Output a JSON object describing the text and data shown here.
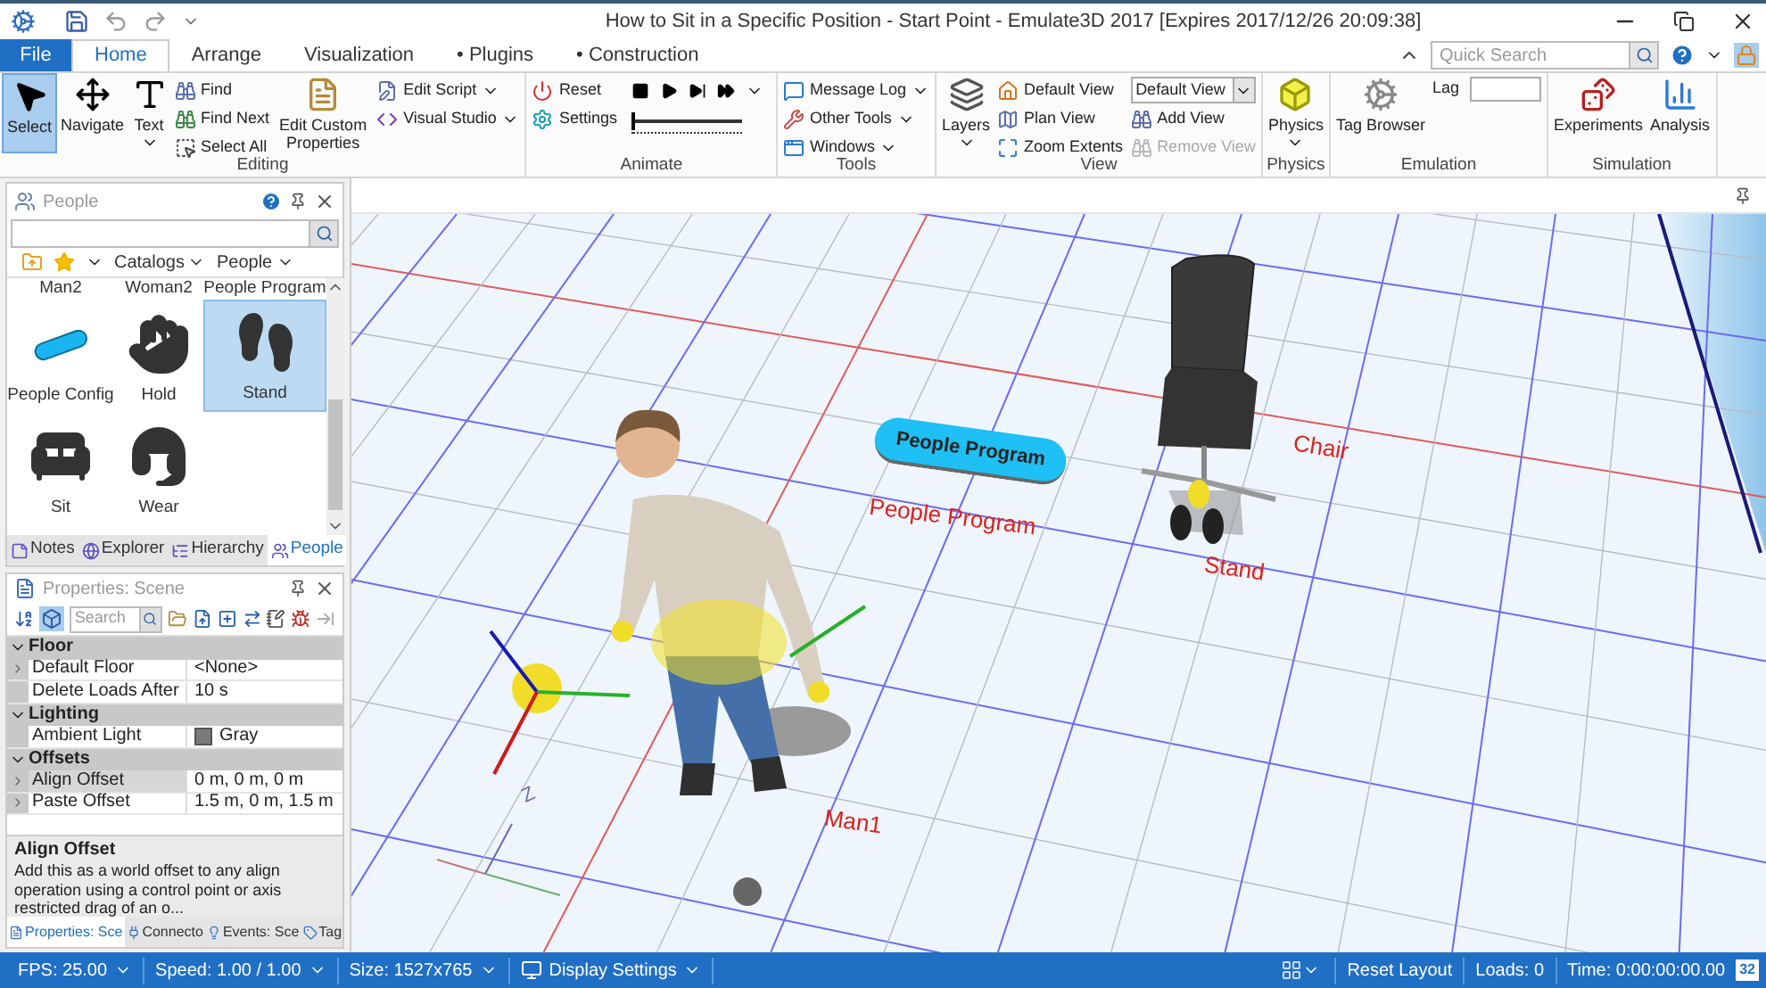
{
  "window": {
    "title": "How to Sit in a Specific Position - Start Point - Emulate3D 2017 [Expires 2017/12/26 20:09:38]"
  },
  "ribbon": {
    "tabs": [
      {
        "label": "File",
        "kind": "file",
        "selected": false
      },
      {
        "label": "Home",
        "kind": "tab",
        "selected": true
      },
      {
        "label": "Arrange",
        "kind": "tab",
        "selected": false
      },
      {
        "label": "Visualization",
        "kind": "tab",
        "selected": false
      },
      {
        "label": "• Plugins",
        "kind": "tab",
        "selected": false
      },
      {
        "label": "• Construction",
        "kind": "tab",
        "selected": false
      }
    ],
    "quick_search": {
      "placeholder": "Quick Search"
    },
    "groups": [
      {
        "label": "Editing",
        "items": [
          {
            "kind": "large",
            "label": "Select",
            "selected": true,
            "dropdown": false
          },
          {
            "kind": "large",
            "label": "Navigate",
            "selected": false,
            "dropdown": false
          },
          {
            "kind": "large",
            "label": "Text",
            "selected": false,
            "dropdown": true
          },
          {
            "kind": "stack",
            "items": [
              {
                "kind": "small",
                "label": "Find",
                "dropdown": false,
                "disabled": false
              },
              {
                "kind": "small",
                "label": "Find Next",
                "dropdown": false,
                "disabled": false
              },
              {
                "kind": "small",
                "label": "Select All",
                "dropdown": false,
                "disabled": false
              }
            ]
          },
          {
            "kind": "large",
            "label": "Edit Custom Properties",
            "selected": false,
            "dropdown": false
          },
          {
            "kind": "stack",
            "items": [
              {
                "kind": "small",
                "label": "Edit Script",
                "dropdown": true,
                "disabled": false
              },
              {
                "kind": "small",
                "label": "Visual Studio",
                "dropdown": true,
                "disabled": false
              }
            ]
          }
        ]
      },
      {
        "label": "Animate",
        "items": [
          {
            "kind": "stack",
            "items": [
              {
                "kind": "small",
                "label": "Reset",
                "dropdown": false,
                "disabled": false
              },
              {
                "kind": "small",
                "label": "Settings",
                "dropdown": false,
                "disabled": false
              }
            ]
          },
          {
            "kind": "stack",
            "items": [
              {
                "kind": "transport"
              },
              {
                "kind": "slider",
                "level": 0
              }
            ]
          }
        ]
      },
      {
        "label": "Tools",
        "items": [
          {
            "kind": "stack",
            "items": [
              {
                "kind": "small",
                "label": "Message Log",
                "dropdown": true,
                "disabled": false
              },
              {
                "kind": "small",
                "label": "Other Tools",
                "dropdown": true,
                "disabled": false
              },
              {
                "kind": "small",
                "label": "Windows",
                "dropdown": true,
                "disabled": false
              }
            ]
          }
        ]
      },
      {
        "label": "View",
        "items": [
          {
            "kind": "large",
            "label": "Layers",
            "selected": false,
            "dropdown": true
          },
          {
            "kind": "stack",
            "items": [
              {
                "kind": "small",
                "label": "Default View",
                "dropdown": false,
                "disabled": false
              },
              {
                "kind": "small",
                "label": "Plan View",
                "dropdown": false,
                "disabled": false
              },
              {
                "kind": "small",
                "label": "Zoom Extents",
                "dropdown": false,
                "disabled": false
              }
            ]
          },
          {
            "kind": "stack",
            "items": [
              {
                "kind": "select",
                "value": "Default View"
              },
              {
                "kind": "small",
                "label": "Add View",
                "dropdown": false,
                "disabled": false
              },
              {
                "kind": "small",
                "label": "Remove View",
                "dropdown": false,
                "disabled": true
              }
            ]
          }
        ]
      },
      {
        "label": "Physics",
        "items": [
          {
            "kind": "large",
            "label": "Physics",
            "selected": false,
            "dropdown": true
          }
        ]
      },
      {
        "label": "Emulation",
        "items": [
          {
            "kind": "large",
            "label": "Tag Browser",
            "selected": false,
            "dropdown": false
          },
          {
            "kind": "stack",
            "items": [
              {
                "kind": "field",
                "label": "Lag"
              }
            ]
          }
        ]
      },
      {
        "label": "Simulation",
        "items": [
          {
            "kind": "large",
            "label": "Experiments",
            "selected": false,
            "dropdown": false
          },
          {
            "kind": "large",
            "label": "Analysis",
            "selected": false,
            "dropdown": false
          }
        ]
      }
    ]
  },
  "people_panel": {
    "title": "People",
    "toolbar": [
      {
        "label": "Catalogs",
        "dropdown": true
      },
      {
        "label": "People",
        "dropdown": true
      }
    ],
    "catalog_items": [
      {
        "label": "Man2",
        "kind": "partial",
        "selected": false
      },
      {
        "label": "Woman2",
        "kind": "partial",
        "selected": false
      },
      {
        "label": "People Program",
        "kind": "partial",
        "selected": false
      },
      {
        "label": "People Config",
        "kind": "full",
        "selected": false
      },
      {
        "label": "Hold",
        "kind": "full",
        "selected": false
      },
      {
        "label": "Stand",
        "kind": "full",
        "selected": true
      },
      {
        "label": "Sit",
        "kind": "full",
        "selected": false
      },
      {
        "label": "Wear",
        "kind": "full",
        "selected": false
      }
    ],
    "tabs": [
      {
        "label": "Notes",
        "selected": false
      },
      {
        "label": "Explorer",
        "selected": false
      },
      {
        "label": "Hierarchy",
        "selected": false
      },
      {
        "label": "People",
        "selected": true
      }
    ]
  },
  "properties_panel": {
    "title": "Properties: Scene",
    "search": {
      "placeholder": "Search"
    },
    "categories": [
      {
        "label": "Floor",
        "expanded": true,
        "rows": [
          {
            "name": "Default Floor",
            "value": "<None>",
            "expandable": true,
            "selected": false
          },
          {
            "name": "Delete Loads After",
            "value": "10 s",
            "expandable": false,
            "selected": false
          }
        ]
      },
      {
        "label": "Lighting",
        "expanded": true,
        "rows": [
          {
            "name": "Ambient Light",
            "value": "Gray",
            "expandable": false,
            "selected": false,
            "color": "#7a7a7a"
          }
        ]
      },
      {
        "label": "Offsets",
        "expanded": true,
        "rows": [
          {
            "name": "Align Offset",
            "value": "0 m, 0 m, 0 m",
            "expandable": true,
            "selected": true
          },
          {
            "name": "Paste Offset",
            "value": "1.5 m, 0 m, 1.5 m",
            "expandable": true,
            "selected": false
          }
        ]
      }
    ],
    "description": {
      "title": "Align Offset",
      "text": "Add this as a world offset to any align operation using a control point or axis restricted drag of an o..."
    },
    "tabs": [
      {
        "label": "Properties: Sce",
        "selected": true
      },
      {
        "label": "Connecto",
        "selected": false
      },
      {
        "label": "Events: Sce",
        "selected": false
      },
      {
        "label": "Tag",
        "selected": false
      }
    ]
  },
  "viewport": {
    "labels": [
      {
        "text": "People Program",
        "kind": "badge"
      },
      {
        "text": "People Program",
        "kind": "label"
      },
      {
        "text": "Chair",
        "kind": "label"
      },
      {
        "text": "Stand",
        "kind": "label"
      },
      {
        "text": "Man1",
        "kind": "label"
      },
      {
        "text": "Z",
        "kind": "axis"
      }
    ]
  },
  "status_bar": {
    "left": [
      {
        "label": "FPS: 25.00",
        "dropdown": true
      },
      {
        "label": "Speed: 1.00 / 1.00",
        "dropdown": true
      },
      {
        "label": "Size: 1527x765",
        "dropdown": true
      },
      {
        "label": "Display Settings",
        "dropdown": true
      }
    ],
    "right": [
      {
        "label": "Reset Layout"
      },
      {
        "label": "Loads: 0"
      },
      {
        "label": "Time: 0:00:00:00.00"
      }
    ],
    "badge": "32"
  }
}
